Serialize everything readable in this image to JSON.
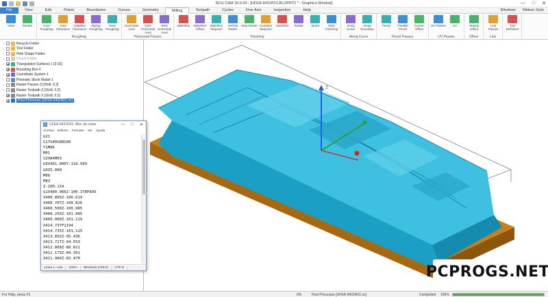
{
  "window": {
    "title": "NCG CAM 18.0.03 - [UFEA-9431R01.BLOPRT2 * - Graphics Window]",
    "minimize": "—",
    "maximize": "□",
    "close": "✕"
  },
  "menu": {
    "file": "File",
    "tabs": [
      "View",
      "Edit",
      "Points",
      "Boundaries",
      "Curves",
      "Geometry",
      "Milling",
      "Toolpath",
      "Cycles",
      "Five-Axis",
      "Inspection",
      "Help"
    ],
    "active": "Milling",
    "right_items": [
      "Windows",
      "Ribbon Style"
    ]
  },
  "ribbon": {
    "groups": [
      {
        "label": "",
        "buttons": [
          "View",
          "Render"
        ]
      },
      {
        "label": "Roughing",
        "buttons": [
          "Core Roughing",
          "Area Clearance",
          "Adaptive Clearance",
          "Zigzag Roughing",
          "Rest Roughing"
        ]
      },
      {
        "label": "Horizontal Passes",
        "buttons": [
          "Horizontal Area",
          "Core Horizontal Area",
          "Rest Horizontal Area"
        ]
      },
      {
        "label": "Finishing",
        "buttons": [
          "Waterline",
          "Waterline Offset",
          "Waterline Stepover",
          "Vertical Raster",
          "Step Raster",
          "Constant Stepover",
          "Morphed",
          "Radial",
          "Spiral",
          "Rest Finishing"
        ]
      },
      {
        "label": "Along Curve",
        "buttons": [
          "Along Curve",
          "Along Boundary"
        ]
      },
      {
        "label": "Pencil Passes",
        "buttons": [
          "Pencil",
          "Parallel Pencil",
          "Corner Offset"
        ]
      },
      {
        "label": "UV Passes",
        "buttons": [
          "UV Passes",
          "UV"
        ]
      },
      {
        "label": "Offset",
        "buttons": [
          "Steady Offset"
        ]
      },
      {
        "label": "Link",
        "buttons": [
          "Link Passes"
        ]
      },
      {
        "label": "",
        "buttons": [
          "Tool Definition"
        ]
      }
    ]
  },
  "tree": {
    "items": [
      {
        "label": "Recycle Folder",
        "checked": false,
        "icon": "folder-icon",
        "color": "#e8b84a"
      },
      {
        "label": "Tool Folder",
        "checked": false,
        "icon": "folder-icon",
        "color": "#e8b84a"
      },
      {
        "label": "Hole Shape Folder",
        "checked": false,
        "icon": "folder-icon",
        "color": "#e8b84a"
      },
      {
        "label": "Chuck Folder",
        "checked": false,
        "icon": "folder-icon",
        "color": "#cfcfcf",
        "grey": true
      },
      {
        "label": "Triangulated Surfaces 1 [0.02]",
        "checked": true,
        "icon": "surface-icon",
        "color": "#3cb371"
      },
      {
        "label": "Bounding Box 4",
        "checked": true,
        "icon": "box-icon",
        "color": "#d94f4f"
      },
      {
        "label": "Coordinate System 1",
        "checked": true,
        "icon": "axis-icon",
        "color": "#6b6bd9"
      },
      {
        "label": "Prismatic Stock Model 1",
        "checked": false,
        "icon": "stock-icon",
        "color": "#4a8fd0"
      },
      {
        "label": "Raster Passes 3 [16x8, 0.2]",
        "checked": false,
        "icon": "toolpath-icon",
        "color": "#888888"
      },
      {
        "label": "Raster Toolpath 2 [16x8, 0.2]",
        "checked": false,
        "icon": "toolpath-icon",
        "color": "#888888"
      },
      {
        "label": "Raster Toolpath 2 [16x8, 0.2]",
        "checked": true,
        "icon": "toolpath-icon",
        "color": "#888888"
      },
      {
        "label": "Post Processor [UFEA-9431R01.nc]",
        "checked": true,
        "icon": "post-icon",
        "color": "#1f6fd0",
        "selected": true
      }
    ]
  },
  "notepad": {
    "title": "UFEA-9431R01: Bloc de notas",
    "menu": [
      "Archivo",
      "Edición",
      "Formato",
      "Ver",
      "Ayuda"
    ],
    "lines": [
      "G21",
      "G17G40G80G90",
      "T1M06",
      "M01",
      "S2984M03",
      "G0X461.000Y-118.999",
      "G0Z5.000",
      "M08",
      "M83",
      "Z-100.119",
      "G1X460.966Z-100.378F895",
      "X460.866Z-100.619",
      "X460.707Z-100.826",
      "X460.500Z-100.985",
      "X460.259Z-101.085",
      "X460.000Z-101.119",
      "X414.737F1194",
      "X414.735Z-101.115",
      "X413.892Z-95.436",
      "X413.727Z-94.553",
      "X412.868Z-88.811",
      "X412.179Z-84.391",
      "X411.984Z-83.470"
    ],
    "status": {
      "position": "Línea 1, colu",
      "zoom": "100%",
      "eol": "Windows (CRLF)",
      "encoding": "UTF-8"
    }
  },
  "viewport": {
    "axis_label": "Z",
    "colors": {
      "part_top": "#3ec1e0",
      "part_side": "#1b9fc4",
      "base": "#c8801a",
      "base_dark": "#8c560e",
      "axis_z": "#2060e0",
      "axis_y": "#2aa02a",
      "origin": "#e02020"
    }
  },
  "statusbar": {
    "left": "For Help, press F1",
    "percent": "0%",
    "middle": "Post Processor [UFEA-9431R01.nc]",
    "completed": "Completed",
    "completed_pct": "100%",
    "progress": 1.0
  },
  "watermark": "PCPROGS.NET"
}
